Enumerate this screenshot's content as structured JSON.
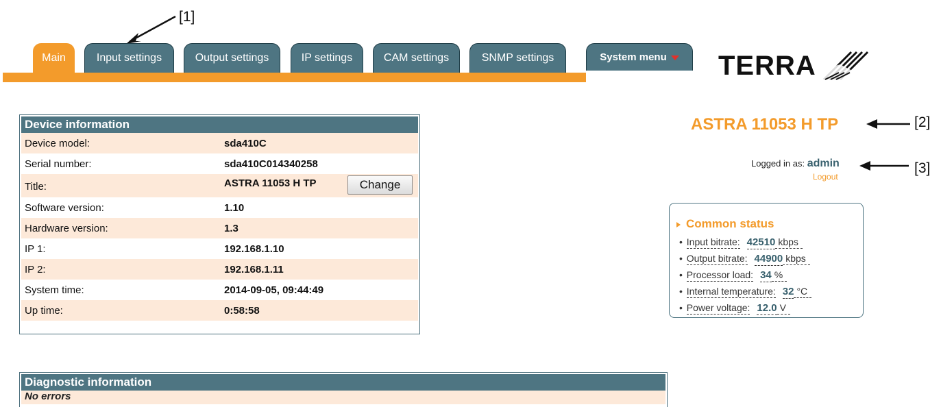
{
  "annotations": {
    "a1": "[1]",
    "a2": "[2]",
    "a3": "[3]"
  },
  "tabs": [
    {
      "label": "Main",
      "active": true
    },
    {
      "label": "Input settings"
    },
    {
      "label": "Output settings"
    },
    {
      "label": "IP settings"
    },
    {
      "label": "CAM settings"
    },
    {
      "label": "SNMP settings"
    },
    {
      "label": "System menu"
    }
  ],
  "logo": {
    "text": "TERRA"
  },
  "device_info": {
    "header": "Device information",
    "rows": [
      {
        "label": "Device model:",
        "value": "sda410C"
      },
      {
        "label": "Serial number:",
        "value": "sda410C014340258"
      },
      {
        "label": "Title:",
        "value": "ASTRA 11053 H TP"
      },
      {
        "label": "Software version:",
        "value": "1.10"
      },
      {
        "label": "Hardware version:",
        "value": "1.3"
      },
      {
        "label": "IP 1:",
        "value": "192.168.1.10"
      },
      {
        "label": "IP 2:",
        "value": "192.168.1.11"
      },
      {
        "label": "System time:",
        "value": "2014-09-05, 09:44:49"
      },
      {
        "label": "Up time:",
        "value": "0:58:58"
      }
    ],
    "change_label": "Change"
  },
  "device_title": "ASTRA 11053 H TP",
  "login": {
    "prefix": "Logged in as:",
    "user": "admin",
    "logout": "Logout"
  },
  "status": {
    "title": "Common status",
    "items": [
      {
        "label": "Input bitrate:",
        "value": "42510",
        "unit": "kbps"
      },
      {
        "label": "Output bitrate:",
        "value": "44900",
        "unit": "kbps"
      },
      {
        "label": "Processor load:",
        "value": "34",
        "unit": "%"
      },
      {
        "label": "Internal temperature:",
        "value": "32",
        "unit": "°C"
      },
      {
        "label": "Power voltage:",
        "value": "12.0",
        "unit": "V"
      }
    ]
  },
  "diagnostic": {
    "header": "Diagnostic information",
    "message": "No errors"
  },
  "colors": {
    "accent": "#f39b2b",
    "tab_dark": "#4e7582",
    "row_alt": "#fde9d9"
  }
}
